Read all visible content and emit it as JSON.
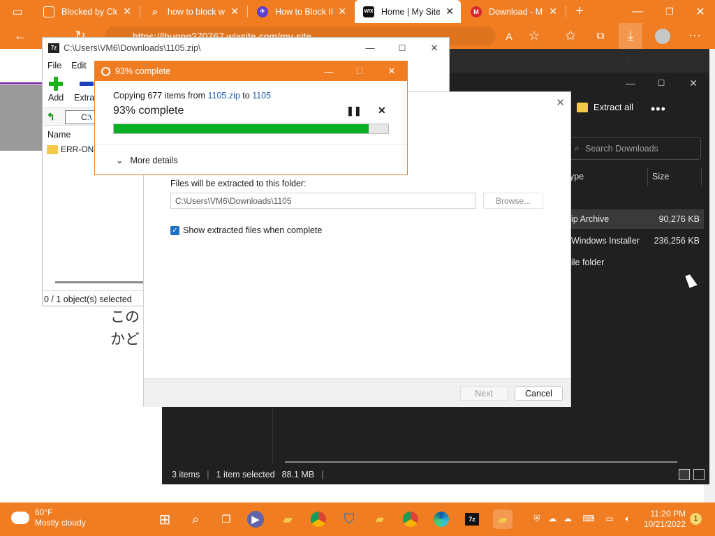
{
  "browser": {
    "tabs": [
      {
        "title": "Blocked by Clou",
        "icon": "document-icon",
        "color": "#ffffff"
      },
      {
        "title": "how to block we",
        "icon": "search-icon",
        "color": "#ffffff"
      },
      {
        "title": "How to Block IP",
        "icon": "vpn-icon",
        "color": "#5b3fd1"
      },
      {
        "title": "Home | My Site",
        "icon": "wix-icon",
        "color": "#111111",
        "active": true
      },
      {
        "title": "Download - ME",
        "icon": "mega-icon",
        "color": "#d9272e"
      }
    ],
    "address": "https://lhuong270767.wixsite.com/my-site",
    "accent": "#f07d22"
  },
  "webpage": {
    "jp_line1": "この",
    "jp_line2": "かど"
  },
  "sevenzip": {
    "title": "C:\\Users\\VM6\\Downloads\\1105.zip\\",
    "logo": "7z",
    "menu": [
      "File",
      "Edit"
    ],
    "tools": [
      {
        "label": "Add"
      },
      {
        "label": "Extrac"
      }
    ],
    "path": "C:\\",
    "column_name": "Name",
    "file": "ERR-ONEC",
    "status": "0 / 1 object(s) selected"
  },
  "progress": {
    "title": "93% complete",
    "copy_prefix": "Copying 677 items from ",
    "copy_source": "1105.zip",
    "copy_mid": " to ",
    "copy_dest": "1105",
    "percent_text": "93% complete",
    "percent": 93,
    "more_details": "More details"
  },
  "wizard": {
    "folder_label": "Files will be extracted to this folder:",
    "folder_value": "C:\\Users\\VM6\\Downloads\\1105",
    "browse": "Browse...",
    "show_files": "Show extracted files when complete",
    "next": "Next",
    "cancel": "Cancel"
  },
  "downloads": {
    "extract_all": "Extract all",
    "search_placeholder": "Search Downloads",
    "col_type": "ype",
    "col_size": "Size",
    "rows": [
      {
        "type": "ip Archive",
        "size": "90,276 KB"
      },
      {
        "type": "Windows Installer ...",
        "size": "236,256 KB"
      },
      {
        "type": "ile folder",
        "size": ""
      }
    ],
    "status_items": "3 items",
    "status_selected": "1 item selected",
    "status_size": "88.1 MB"
  },
  "taskbar": {
    "temp": "60°F",
    "weather": "Mostly cloudy",
    "time": "11:20 PM",
    "date": "10/21/2022",
    "notifications": "1"
  }
}
